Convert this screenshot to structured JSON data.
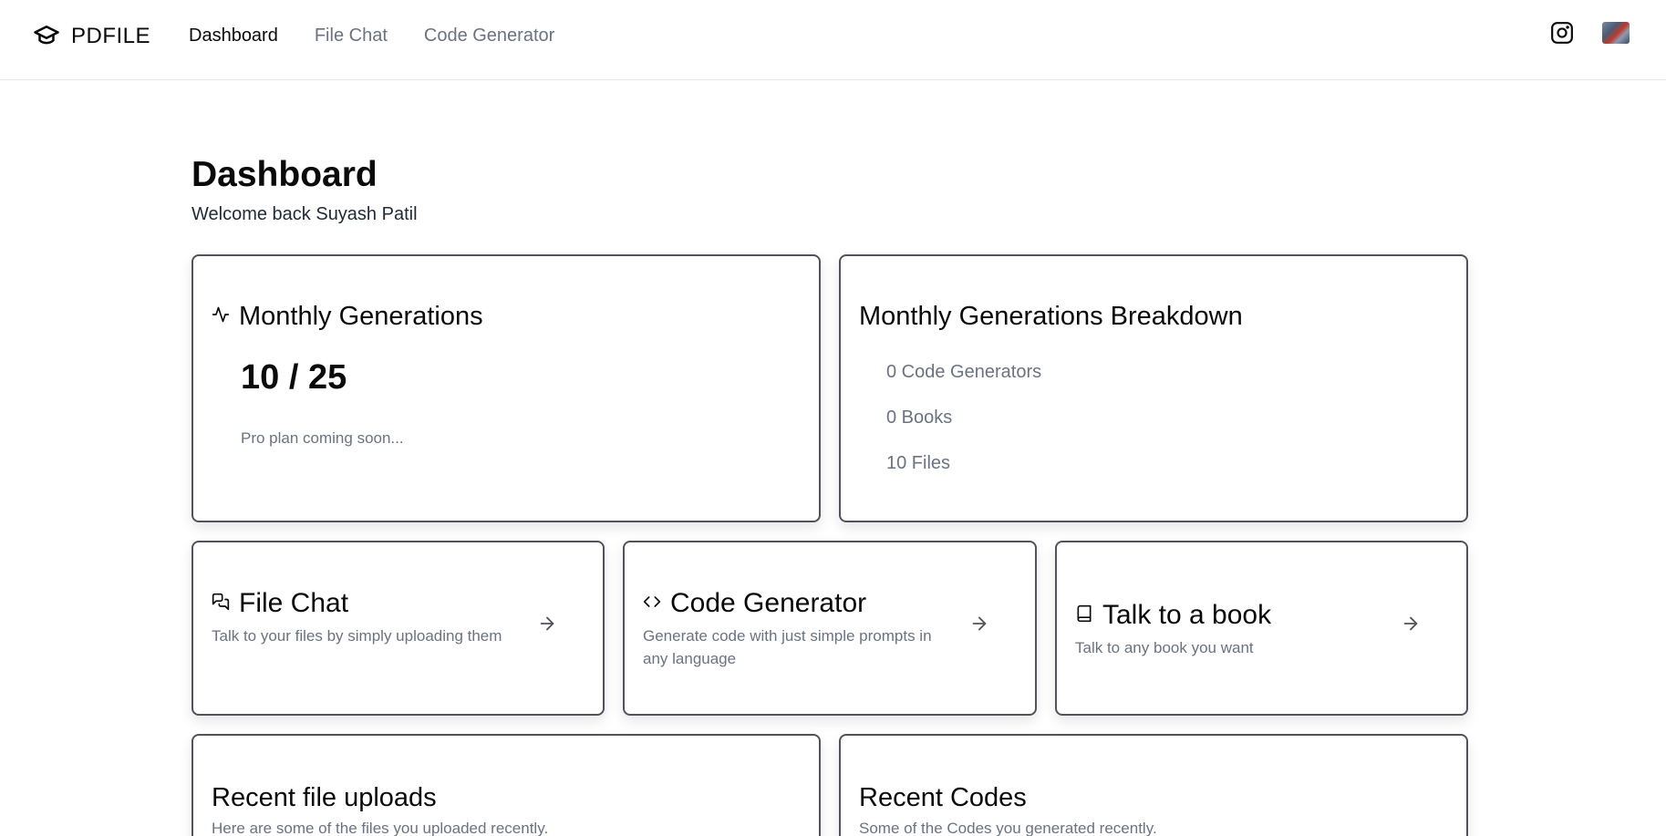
{
  "brand": {
    "name": "PDFILE",
    "icon": "graduation-cap-icon"
  },
  "nav": {
    "items": [
      {
        "label": "Dashboard",
        "active": true
      },
      {
        "label": "File Chat",
        "active": false
      },
      {
        "label": "Code Generator",
        "active": false
      }
    ]
  },
  "header": {
    "instagram_icon": "instagram-icon",
    "avatar_icon": "user-avatar"
  },
  "page": {
    "title": "Dashboard",
    "welcome": "Welcome back Suyash Patil"
  },
  "monthly": {
    "icon": "activity-icon",
    "title": "Monthly Generations",
    "value": "10 / 25",
    "note": "Pro plan coming soon..."
  },
  "breakdown": {
    "title": "Monthly Generations Breakdown",
    "items": [
      "0 Code Generators",
      "0 Books",
      "10 Files"
    ]
  },
  "features": [
    {
      "icon": "messages-icon",
      "title": "File Chat",
      "desc": "Talk to your files by simply uploading them"
    },
    {
      "icon": "code-icon",
      "title": "Code Generator",
      "desc": "Generate code with just simple prompts in any language"
    },
    {
      "icon": "book-icon",
      "title": "Talk to a book",
      "desc": "Talk to any book you want"
    }
  ],
  "recent": {
    "files": {
      "title": "Recent file uploads",
      "desc": "Here are some of the files you uploaded recently."
    },
    "codes": {
      "title": "Recent Codes",
      "desc": "Some of the Codes you generated recently."
    }
  },
  "colors": {
    "text": "#0a0a0a",
    "muted": "#6b7280",
    "border": "#52525b"
  }
}
